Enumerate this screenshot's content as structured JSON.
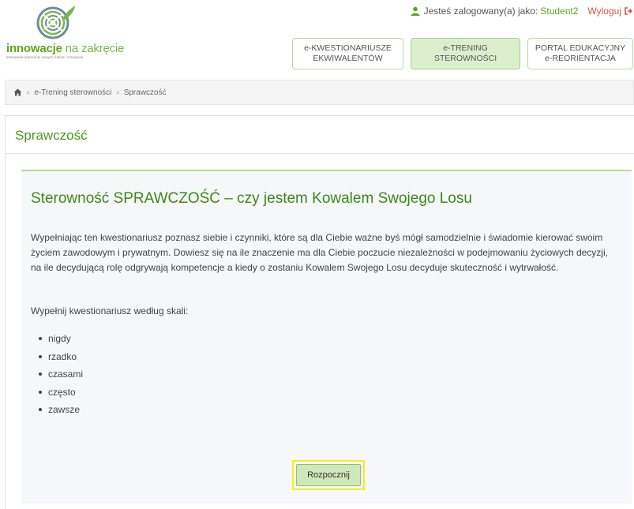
{
  "header": {
    "logo": {
      "brand_bold": "innowacje",
      "brand_rest": " na zakręcie",
      "tagline": "testowanie wdrażanie nowych metod i rozwiązań"
    },
    "user": {
      "logged_in_label": "Jesteś zalogowany(a) jako:",
      "username": "Student2",
      "logout_label": "Wyloguj"
    },
    "nav": [
      {
        "line1": "e-KWESTIONARIUSZE",
        "line2": "EKWIWALENTÓW",
        "active": false
      },
      {
        "line1": "e-TRENING",
        "line2": "STEROWNOŚCI",
        "active": true
      },
      {
        "line1": "PORTAL EDUKACYJNY",
        "line2": "e-REORIENTACJA",
        "active": false
      }
    ]
  },
  "breadcrumb": {
    "items": [
      "e-Trening sterowności",
      "Sprawczość"
    ],
    "separator": "›"
  },
  "panel": {
    "title": "Sprawczość",
    "content_title": "Sterowność SPRAWCZOŚĆ – czy jestem Kowalem Swojego Losu",
    "intro": "Wypełniając ten kwestionariusz poznasz siebie i czynniki, które są dla Ciebie ważne byś mógł samodzielnie i świadomie kierować swoim życiem zawodowym i prywatnym. Dowiesz się na ile znaczenie ma dla Ciebie poczucie niezależności w podejmowaniu życiowych decyzji, na ile decydującą rolę odgrywają kompetencje a kiedy o zostaniu Kowalem Swojego Losu decyduje skuteczność i wytrwałość.",
    "scale_lead": "Wypełnij kwestionariusz według skali:",
    "scale": [
      "nigdy",
      "rzadko",
      "czasami",
      "często",
      "zawsze"
    ],
    "start_label": "Rozpocznij"
  },
  "colors": {
    "brand_green": "#5fa51c",
    "title_green": "#3a8a18",
    "active_tab": "#dcefcc",
    "button_fill": "#cfe8b9",
    "focus_outline": "#f3ee1a",
    "logout_red": "#d9534f"
  },
  "icons": {
    "user": "user-icon",
    "logout": "sign-out-icon",
    "home": "home-icon",
    "logo": "spiral-leaf-logo"
  }
}
